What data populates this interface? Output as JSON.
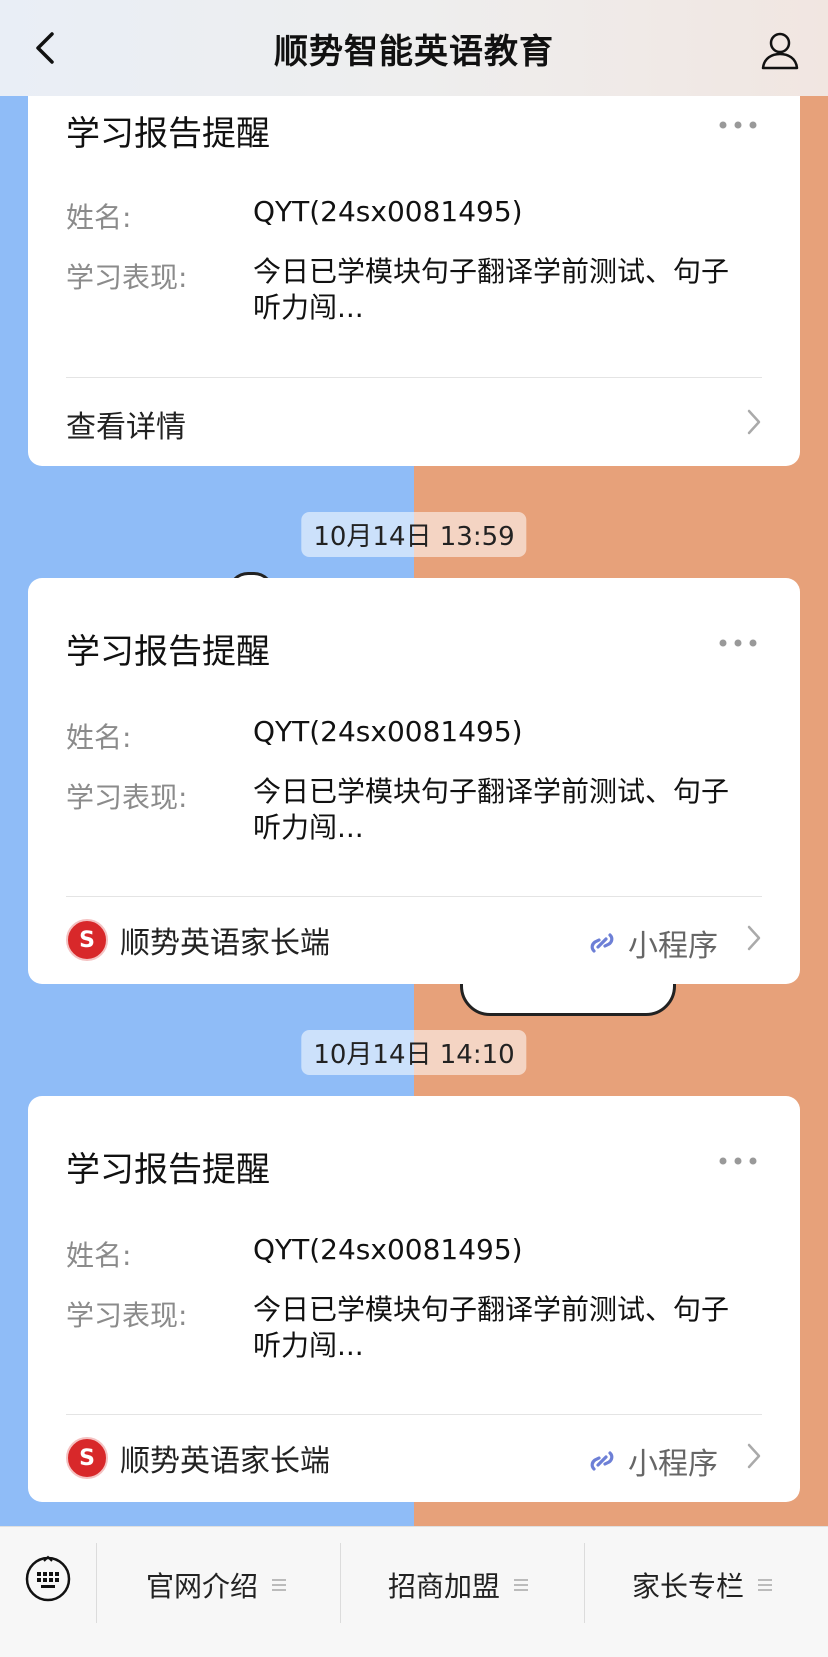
{
  "header": {
    "title": "顺势智能英语教育"
  },
  "cards": [
    {
      "title": "学习报告提醒",
      "name_label": "姓名:",
      "name_value": "QYT(24sx0081495)",
      "performance_label": "学习表现:",
      "performance_value": "今日已学模块句子翻译学前测试、句子听力闯...",
      "footer_text": "查看详情"
    },
    {
      "timestamp": "10月14日 13:59",
      "title": "学习报告提醒",
      "name_label": "姓名:",
      "name_value": "QYT(24sx0081495)",
      "performance_label": "学习表现:",
      "performance_value": "今日已学模块句子翻译学前测试、句子听力闯...",
      "footer_text": "顺势英语家长端",
      "miniprogram_label": "小程序",
      "logo_letter": "S"
    },
    {
      "timestamp": "10月14日 14:10",
      "title": "学习报告提醒",
      "name_label": "姓名:",
      "name_value": "QYT(24sx0081495)",
      "performance_label": "学习表现:",
      "performance_value": "今日已学模块句子翻译学前测试、句子听力闯...",
      "footer_text": "顺势英语家长端",
      "miniprogram_label": "小程序",
      "logo_letter": "S"
    }
  ],
  "bottom_nav": {
    "items": [
      "官网介绍",
      "招商加盟",
      "家长专栏"
    ]
  },
  "icons": {
    "back": "chevron-left-icon",
    "user": "user-icon",
    "more": "more-dots-icon",
    "keyboard": "keyboard-icon",
    "miniprogram": "miniprogram-link-icon",
    "chevron": "chevron-right-icon",
    "menu": "menu-lines-icon"
  },
  "colors": {
    "left_bg": "#8fbcf7",
    "right_bg": "#e7a17a",
    "logo_red": "#d8282a",
    "mp_blue": "#6d7fd6"
  }
}
